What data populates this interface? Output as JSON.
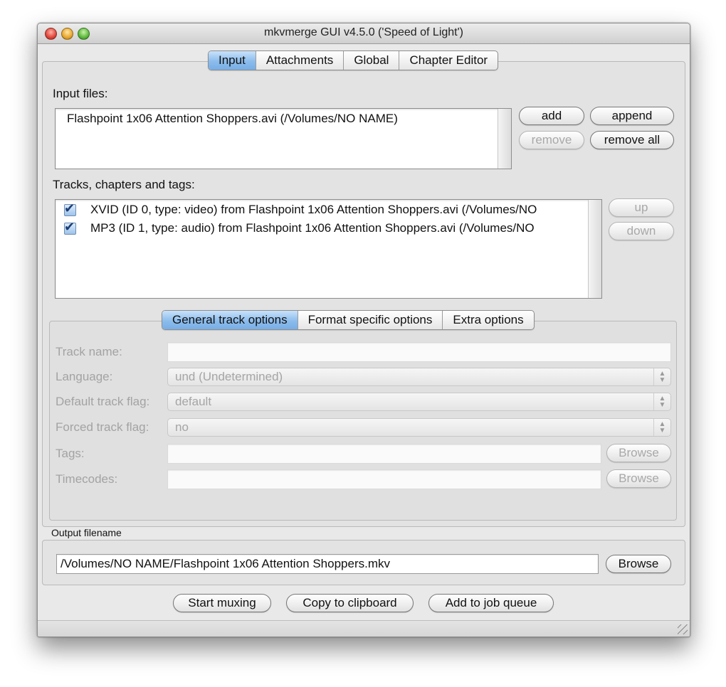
{
  "window": {
    "title": "mkvmerge GUI v4.5.0 ('Speed of Light')"
  },
  "main_tabs": [
    {
      "label": "Input",
      "active": true
    },
    {
      "label": "Attachments",
      "active": false
    },
    {
      "label": "Global",
      "active": false
    },
    {
      "label": "Chapter Editor",
      "active": false
    }
  ],
  "input": {
    "files_label": "Input files:",
    "files": [
      "Flashpoint 1x06 Attention Shoppers.avi (/Volumes/NO NAME)"
    ],
    "buttons": {
      "add": "add",
      "append": "append",
      "remove": "remove",
      "remove_all": "remove all"
    },
    "tracks_label": "Tracks, chapters and tags:",
    "tracks": [
      {
        "checked": true,
        "text": "XVID (ID 0, type: video) from Flashpoint 1x06 Attention Shoppers.avi (/Volumes/NO"
      },
      {
        "checked": true,
        "text": "MP3 (ID 1, type: audio) from Flashpoint 1x06 Attention Shoppers.avi (/Volumes/NO"
      }
    ],
    "track_buttons": {
      "up": "up",
      "down": "down"
    }
  },
  "track_tabs": [
    {
      "label": "General track options",
      "active": true
    },
    {
      "label": "Format specific options",
      "active": false
    },
    {
      "label": "Extra options",
      "active": false
    }
  ],
  "track_options": {
    "track_name_label": "Track name:",
    "track_name_value": "",
    "language_label": "Language:",
    "language_value": "und (Undetermined)",
    "default_flag_label": "Default track flag:",
    "default_flag_value": "default",
    "forced_flag_label": "Forced track flag:",
    "forced_flag_value": "no",
    "tags_label": "Tags:",
    "tags_value": "",
    "timecodes_label": "Timecodes:",
    "timecodes_value": "",
    "browse_label": "Browse"
  },
  "output": {
    "label": "Output filename",
    "filename": "/Volumes/NO NAME/Flashpoint 1x06 Attention Shoppers.mkv",
    "browse_label": "Browse"
  },
  "actions": {
    "start": "Start muxing",
    "copy": "Copy to clipboard",
    "queue": "Add to job queue"
  },
  "icons": {
    "stepper": "up-down-arrows-icon",
    "checkbox": "checkmark-icon",
    "grip": "resize-grip-icon"
  }
}
